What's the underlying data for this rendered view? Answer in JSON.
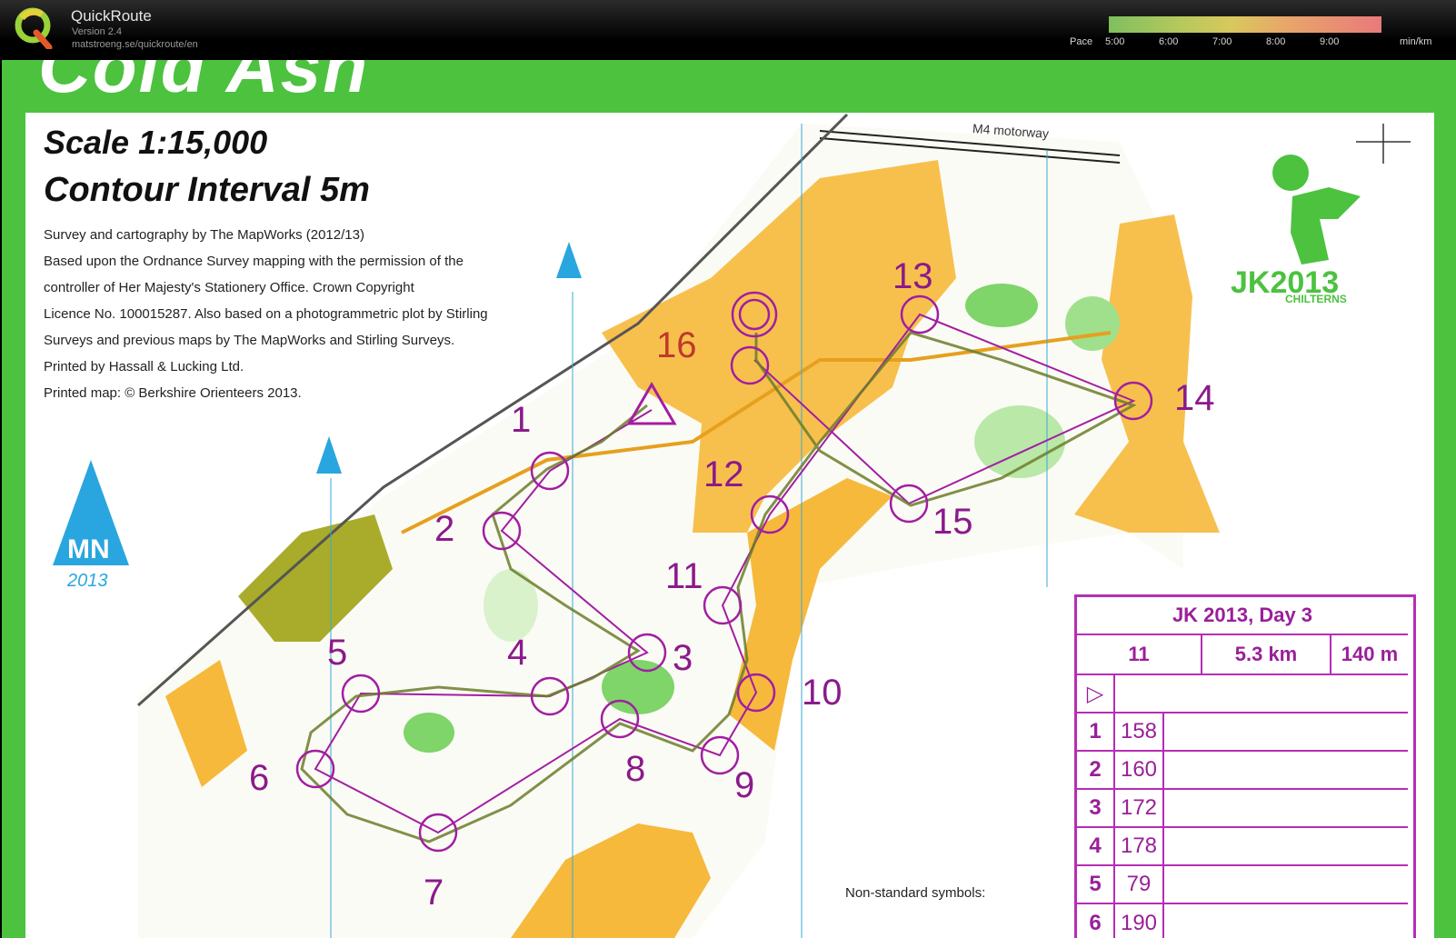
{
  "app": {
    "title": "QuickRoute",
    "version": "Version 2.4",
    "url": "matstroeng.se/quickroute/en"
  },
  "pace": {
    "label": "Pace",
    "ticks": [
      "5:00",
      "6:00",
      "7:00",
      "8:00",
      "9:00"
    ],
    "unit": "min/km"
  },
  "map": {
    "banner_text": "Cold Ash",
    "scale": "Scale 1:15,000",
    "contour": "Contour Interval 5m",
    "credits": [
      "Survey and cartography by The MapWorks (2012/13)",
      "Based upon the Ordnance Survey mapping with the permission of the",
      "controller of Her Majesty's Stationery Office. Crown Copyright",
      "Licence No. 100015287. Also based  on a photogrammetric plot by Stirling",
      "Surveys and previous maps by The MapWorks and Stirling Surveys.",
      "Printed by Hassall & Lucking Ltd.",
      "Printed map: © Berkshire Orienteers 2013."
    ],
    "motorway": "M4 motorway",
    "north": {
      "label": "MN",
      "year": "2013"
    },
    "logo": {
      "jk": "JK",
      "year": "2013",
      "region": "CHILTERNS"
    },
    "controls": [
      "1",
      "2",
      "3",
      "4",
      "5",
      "6",
      "7",
      "8",
      "9",
      "10",
      "11",
      "12",
      "13",
      "14",
      "15",
      "16"
    ],
    "non_standard": "Non-standard symbols:",
    "colors": {
      "border_green": "#4cc23f",
      "course_purple": "#9a1f9a",
      "orange": "#f6b93b"
    }
  },
  "control_description": {
    "title": "JK 2013, Day 3",
    "course": "11",
    "length": "5.3 km",
    "climb": "140 m",
    "rows": [
      {
        "num": "1",
        "code": "158"
      },
      {
        "num": "2",
        "code": "160"
      },
      {
        "num": "3",
        "code": "172"
      },
      {
        "num": "4",
        "code": "178"
      },
      {
        "num": "5",
        "code": "79"
      },
      {
        "num": "6",
        "code": "190"
      }
    ]
  }
}
